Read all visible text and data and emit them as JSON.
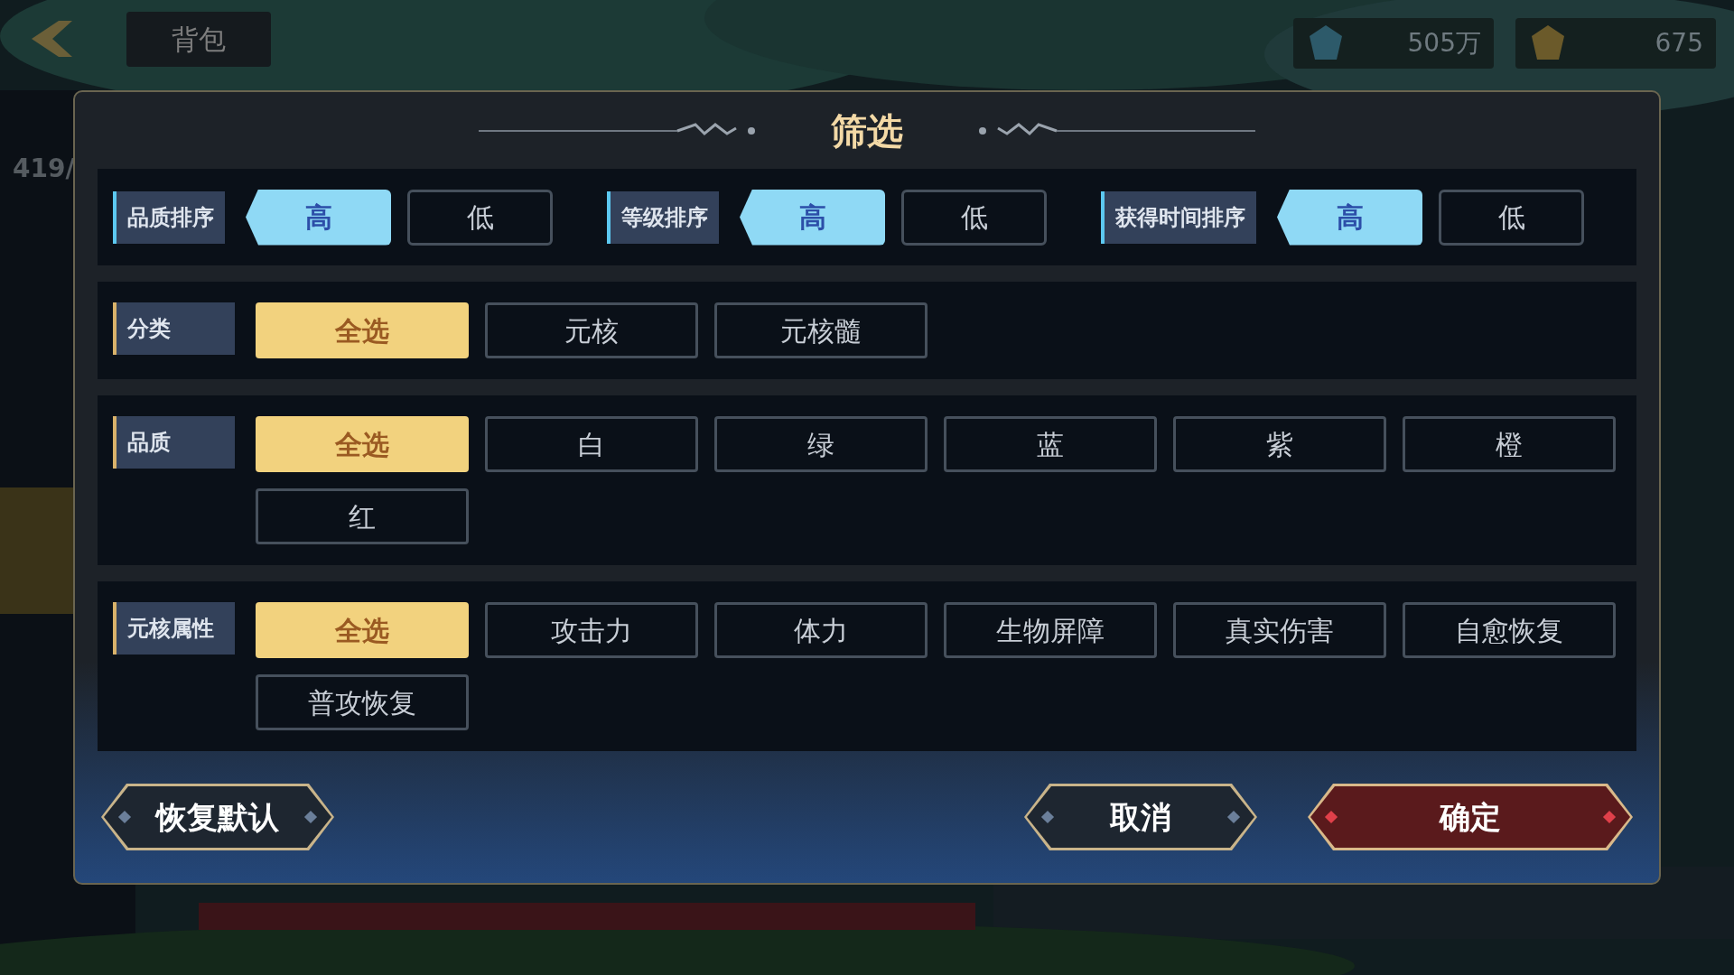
{
  "background": {
    "back_label": "背包",
    "level_count": "419/",
    "currencies": [
      {
        "amount": "505万"
      },
      {
        "amount": "675"
      }
    ]
  },
  "dialog": {
    "title": "筛选",
    "sort_groups": [
      {
        "label": "品质排序",
        "options": [
          {
            "label": "高",
            "selected": true
          },
          {
            "label": "低",
            "selected": false
          }
        ]
      },
      {
        "label": "等级排序",
        "options": [
          {
            "label": "高",
            "selected": true
          },
          {
            "label": "低",
            "selected": false
          }
        ]
      },
      {
        "label": "获得时间排序",
        "options": [
          {
            "label": "高",
            "selected": true
          },
          {
            "label": "低",
            "selected": false
          }
        ]
      }
    ],
    "filters": [
      {
        "label": "分类",
        "options": [
          {
            "label": "全选",
            "selected": true
          },
          {
            "label": "元核",
            "selected": false
          },
          {
            "label": "元核髓",
            "selected": false
          }
        ]
      },
      {
        "label": "品质",
        "options": [
          {
            "label": "全选",
            "selected": true
          },
          {
            "label": "白",
            "selected": false
          },
          {
            "label": "绿",
            "selected": false
          },
          {
            "label": "蓝",
            "selected": false
          },
          {
            "label": "紫",
            "selected": false
          },
          {
            "label": "橙",
            "selected": false
          },
          {
            "label": "红",
            "selected": false
          }
        ]
      },
      {
        "label": "元核属性",
        "options": [
          {
            "label": "全选",
            "selected": true
          },
          {
            "label": "攻击力",
            "selected": false
          },
          {
            "label": "体力",
            "selected": false
          },
          {
            "label": "生物屏障",
            "selected": false
          },
          {
            "label": "真实伤害",
            "selected": false
          },
          {
            "label": "自愈恢复",
            "selected": false
          },
          {
            "label": "普攻恢复",
            "selected": false
          }
        ]
      }
    ],
    "buttons": [
      {
        "label": "恢复默认",
        "kind": "reset"
      },
      {
        "label": "取消",
        "kind": "cancel"
      },
      {
        "label": "确定",
        "kind": "confirm"
      }
    ]
  }
}
